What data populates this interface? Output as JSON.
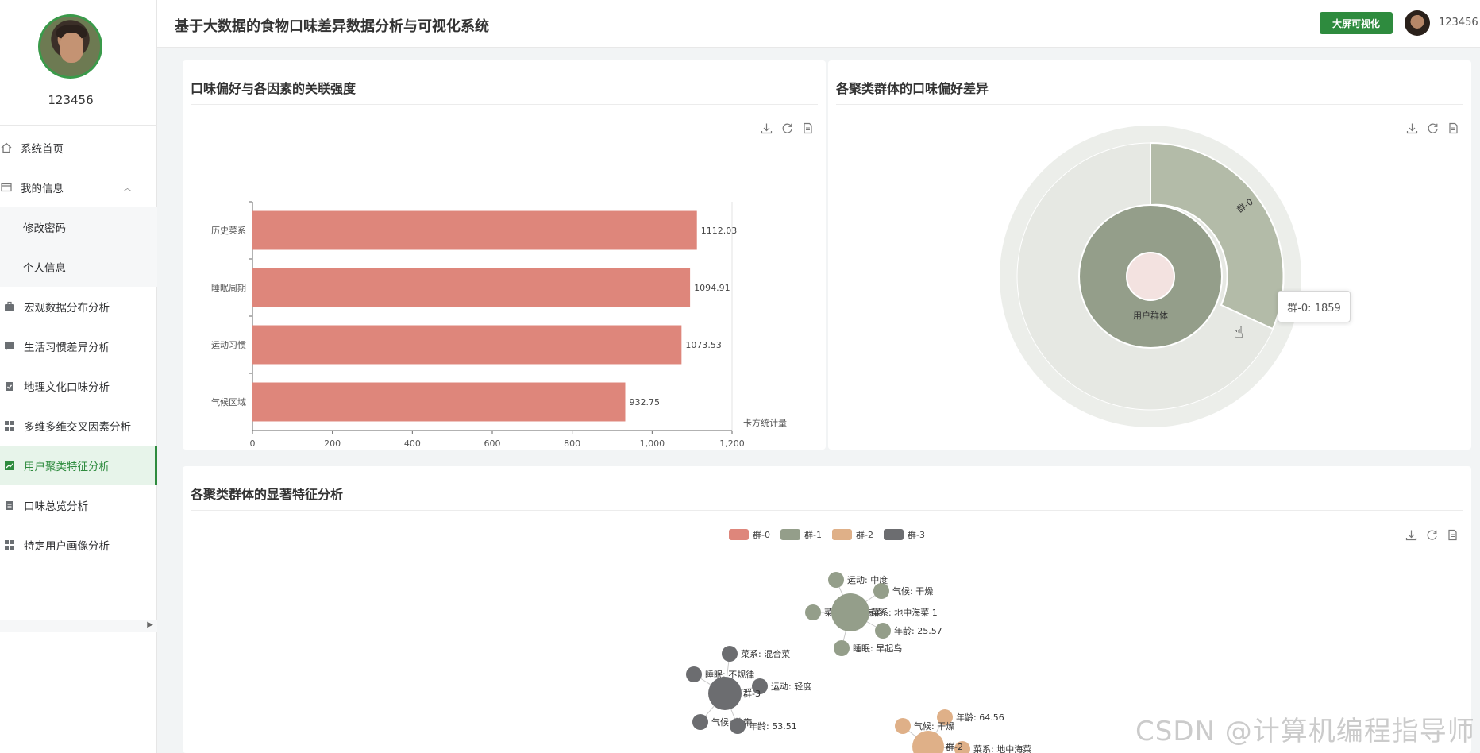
{
  "sidebar": {
    "username": "123456",
    "items": [
      {
        "label": "系统首页",
        "icon": "home-icon"
      },
      {
        "label": "我的信息",
        "icon": "id-card-icon"
      },
      {
        "label": "修改密码",
        "icon": ""
      },
      {
        "label": "个人信息",
        "icon": ""
      },
      {
        "label": "宏观数据分布分析",
        "icon": "briefcase-icon"
      },
      {
        "label": "生活习惯差异分析",
        "icon": "chat-icon"
      },
      {
        "label": "地理文化口味分析",
        "icon": "clipboard-check-icon"
      },
      {
        "label": "多维多维交叉因素分析",
        "icon": "grid-icon"
      },
      {
        "label": "用户聚类特征分析",
        "icon": "trend-icon"
      },
      {
        "label": "口味总览分析",
        "icon": "clipboard-icon"
      },
      {
        "label": "特定用户画像分析",
        "icon": "grid-icon"
      }
    ]
  },
  "header": {
    "title": "基于大数据的食物口味差异数据分析与可视化系统",
    "big_screen_label": "大屏可视化",
    "username": "123456"
  },
  "panels": {
    "association": {
      "title": "口味偏好与各因素的关联强度"
    },
    "sunburst": {
      "title": "各聚类群体的口味偏好差异",
      "tooltip": "群-0: 1859"
    },
    "features": {
      "title": "各聚类群体的显著特征分析"
    }
  },
  "watermark": "CSDN @计算机编程指导师",
  "colors": {
    "accent": "#2e8b3e",
    "bar": "#de867b",
    "g0": "#de867b",
    "g1": "#949e8a",
    "g2": "#dfb088",
    "g3": "#6c6d70"
  },
  "chart_data": [
    {
      "type": "bar",
      "orientation": "horizontal",
      "categories": [
        "历史菜系",
        "睡眠周期",
        "运动习惯",
        "气候区域"
      ],
      "values": [
        1112.03,
        1094.91,
        1073.53,
        932.75
      ],
      "value_labels": [
        "1112.03",
        "1094.91",
        "1073.53",
        "932.75"
      ],
      "xlabel": "卡方统计量",
      "xlim": [
        0,
        1200
      ],
      "xticks": [
        0,
        200,
        400,
        600,
        800,
        1000,
        1200
      ],
      "xtick_labels": [
        "0",
        "200",
        "400",
        "600",
        "800",
        "1,000",
        "1,200"
      ]
    },
    {
      "type": "sunburst",
      "center_label": "用户群体",
      "inner_ring": [
        {
          "name": "群-0",
          "value": 1859
        }
      ],
      "highlight_label": "群-0"
    },
    {
      "type": "graph",
      "legend": [
        "群-0",
        "群-1",
        "群-2",
        "群-3"
      ],
      "groups": [
        {
          "name": "群-1",
          "color": "#949e8a",
          "label": "菜系: 地中海菜 1",
          "nodes": [
            "运动: 中度",
            "气候: 干燥",
            "菜系: 地中海菜",
            "年龄: 25.57",
            "睡眠: 早起鸟"
          ]
        },
        {
          "name": "群-3",
          "color": "#6c6d70",
          "label": "群-3",
          "nodes": [
            "菜系: 混合菜",
            "睡眠: 不规律",
            "运动: 轻度",
            "气候: 热带",
            "年龄: 53.51"
          ]
        },
        {
          "name": "群-2",
          "color": "#dfb088",
          "label": "群-2",
          "nodes": [
            "年龄: 64.56",
            "气候: 干燥",
            "菜系: 地中海菜"
          ]
        }
      ]
    }
  ]
}
